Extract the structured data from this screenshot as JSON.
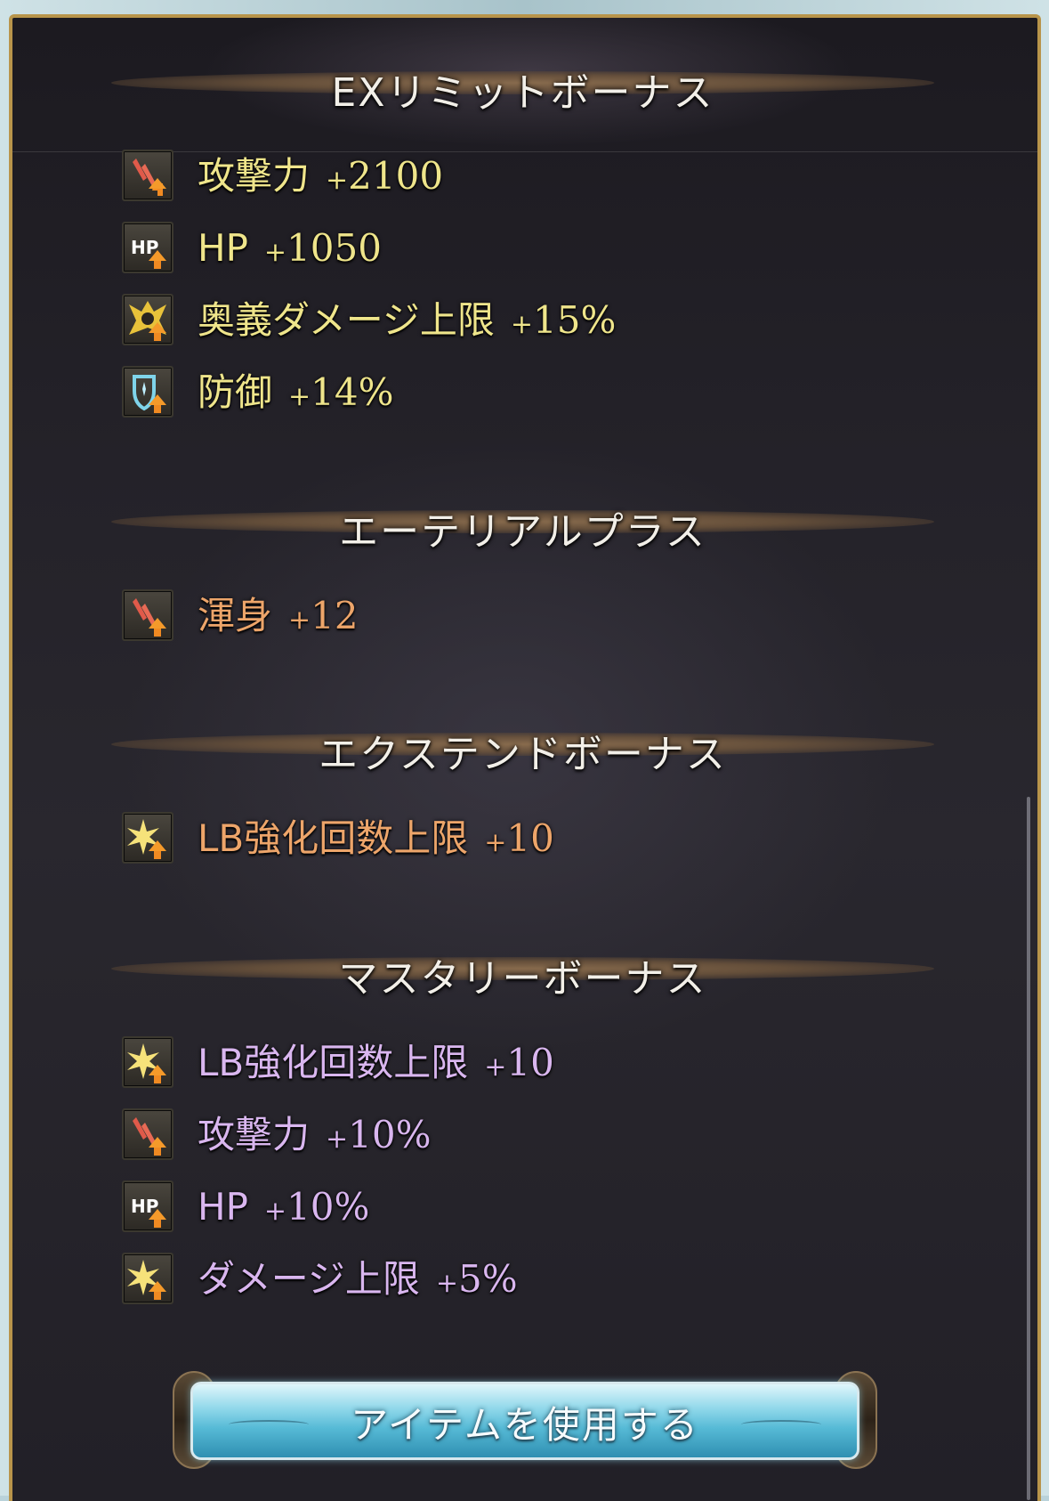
{
  "sections": [
    {
      "title": "EXリミットボーナス",
      "items": [
        {
          "icon": "attack-up-icon",
          "label": "攻撃力",
          "value": "2100",
          "color": "#efe58b"
        },
        {
          "icon": "hp-up-icon",
          "label": "HP",
          "value": "1050",
          "color": "#efe58b"
        },
        {
          "icon": "ougi-damage-cap-up-icon",
          "label": "奥義ダメージ上限",
          "value": "15%",
          "color": "#efe58b"
        },
        {
          "icon": "defense-up-icon",
          "label": "防御",
          "value": "14%",
          "color": "#efe58b"
        }
      ]
    },
    {
      "title": "エーテリアルプラス",
      "items": [
        {
          "icon": "attack-up-icon",
          "label": "渾身",
          "value": "12",
          "color": "#eda56a"
        }
      ]
    },
    {
      "title": "エクステンドボーナス",
      "items": [
        {
          "icon": "star-burst-up-icon",
          "label": "LB強化回数上限",
          "value": "10",
          "color": "#eda56a"
        }
      ]
    },
    {
      "title": "マスタリーボーナス",
      "items": [
        {
          "icon": "star-burst-up-icon",
          "label": "LB強化回数上限",
          "value": "10",
          "color": "#d9b6ef"
        },
        {
          "icon": "attack-up-icon",
          "label": "攻撃力",
          "value": "10%",
          "color": "#d9b6ef"
        },
        {
          "icon": "hp-up-icon",
          "label": "HP",
          "value": "10%",
          "color": "#d9b6ef"
        },
        {
          "icon": "star-burst-up-icon",
          "label": "ダメージ上限",
          "value": "5%",
          "color": "#d9b6ef"
        }
      ]
    }
  ],
  "plus_sign": "+",
  "use_item_button": {
    "label": "アイテムを使用する"
  },
  "colors": {
    "frame": "#b8944a",
    "button": "#56bad6"
  }
}
